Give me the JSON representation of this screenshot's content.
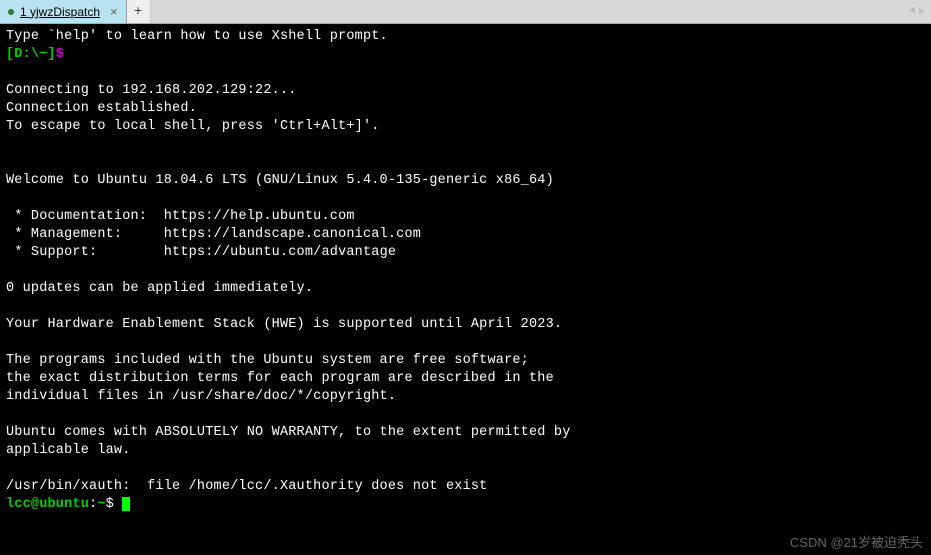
{
  "tab": {
    "label": "1 yjwzDispatch",
    "close": "×"
  },
  "tab_add": "+",
  "nav": {
    "left": "◄",
    "right": "▶"
  },
  "terminal": {
    "help_line": "Type `help' to learn how to use Xshell prompt.",
    "prompt_loc": "[D:\\~]",
    "prompt_dollar": "$",
    "connecting": "Connecting to 192.168.202.129:22...",
    "established": "Connection established.",
    "escape": "To escape to local shell, press 'Ctrl+Alt+]'.",
    "welcome": "Welcome to Ubuntu 18.04.6 LTS (GNU/Linux 5.4.0-135-generic x86_64)",
    "doc_line": " * Documentation:  https://help.ubuntu.com",
    "mgmt_line": " * Management:     https://landscape.canonical.com",
    "support_line": " * Support:        https://ubuntu.com/advantage",
    "updates": "0 updates can be applied immediately.",
    "hwe": "Your Hardware Enablement Stack (HWE) is supported until April 2023.",
    "programs1": "The programs included with the Ubuntu system are free software;",
    "programs2": "the exact distribution terms for each program are described in the",
    "programs3": "individual files in /usr/share/doc/*/copyright.",
    "warranty1": "Ubuntu comes with ABSOLUTELY NO WARRANTY, to the extent permitted by",
    "warranty2": "applicable law.",
    "xauth": "/usr/bin/xauth:  file /home/lcc/.Xauthority does not exist",
    "remote_prompt_user": "lcc@ubuntu",
    "remote_prompt_sep": ":",
    "remote_prompt_path": "~",
    "remote_prompt_dollar": "$ "
  },
  "watermark": "CSDN @21岁被迫秃头"
}
